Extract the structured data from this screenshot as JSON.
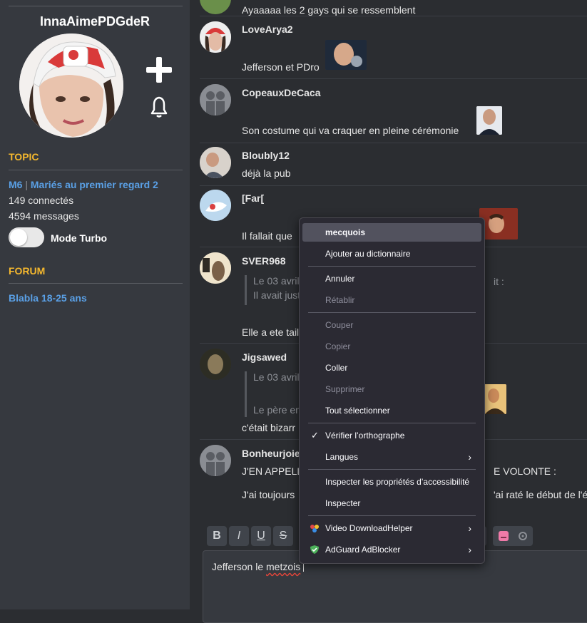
{
  "sidebar": {
    "username": "InnaAimePDGdeR",
    "topic_title": "TOPIC",
    "topic_link_prefix": "M6",
    "topic_link_sep": " | ",
    "topic_link_name": "Mariés au premier regard 2",
    "connected": "149 connectés",
    "messages": "4594 messages",
    "turbo_label": "Mode Turbo",
    "forum_title": "FORUM",
    "forum_link": "Blabla 18-25 ans"
  },
  "messages": [
    {
      "text": "Ayaaaaa les 2 gays qui se ressemblent"
    },
    {
      "author": "LoveArya2",
      "text": "Jefferson et PDro"
    },
    {
      "author": "CopeauxDeCaca",
      "text": "Son costume qui va craquer en pleine cérémonie"
    },
    {
      "author": "Bloubly12",
      "text": "déjà la pub"
    },
    {
      "author": "[Far[",
      "text": "Il fallait que"
    },
    {
      "author": "SVER968",
      "quote1": "Le 03 avril",
      "quote2": "Il avait just",
      "quote_tail": "it :",
      "text": "Elle a ete tail"
    },
    {
      "author": "Jigsawed",
      "quote1": "Le 03 avril",
      "quote2": "Le père en",
      "text": "c'était bizarr"
    },
    {
      "author": "Bonheurjoie",
      "text": "J'EN APPELL",
      "text_tail": "E VOLONTE :",
      "text2": "J'ai toujours",
      "text2_tail": "'ai raté le début de l'ép"
    }
  ],
  "toolbar": {
    "bold": "B",
    "italic": "I",
    "underline": "U",
    "strike": "S"
  },
  "editor": {
    "before": "Jefferson le ",
    "misspelled": "metzois",
    "after": " "
  },
  "context_menu": {
    "suggestion": "mecquois",
    "add_dict": "Ajouter au dictionnaire",
    "undo": "Annuler",
    "redo": "Rétablir",
    "cut": "Couper",
    "copy": "Copier",
    "paste": "Coller",
    "delete": "Supprimer",
    "select_all": "Tout sélectionner",
    "spellcheck": "Vérifier l’orthographe",
    "languages": "Langues",
    "inspect_a11y": "Inspecter les propriétés d’accessibilité",
    "inspect": "Inspecter",
    "video_dl": "Video DownloadHelper",
    "adguard": "AdGuard AdBlocker"
  },
  "colors": {
    "accent_gold": "#f5b82e",
    "link_blue": "#5aa0e6",
    "bg_sidebar": "#36393f",
    "bg_main": "#2b2d31"
  }
}
